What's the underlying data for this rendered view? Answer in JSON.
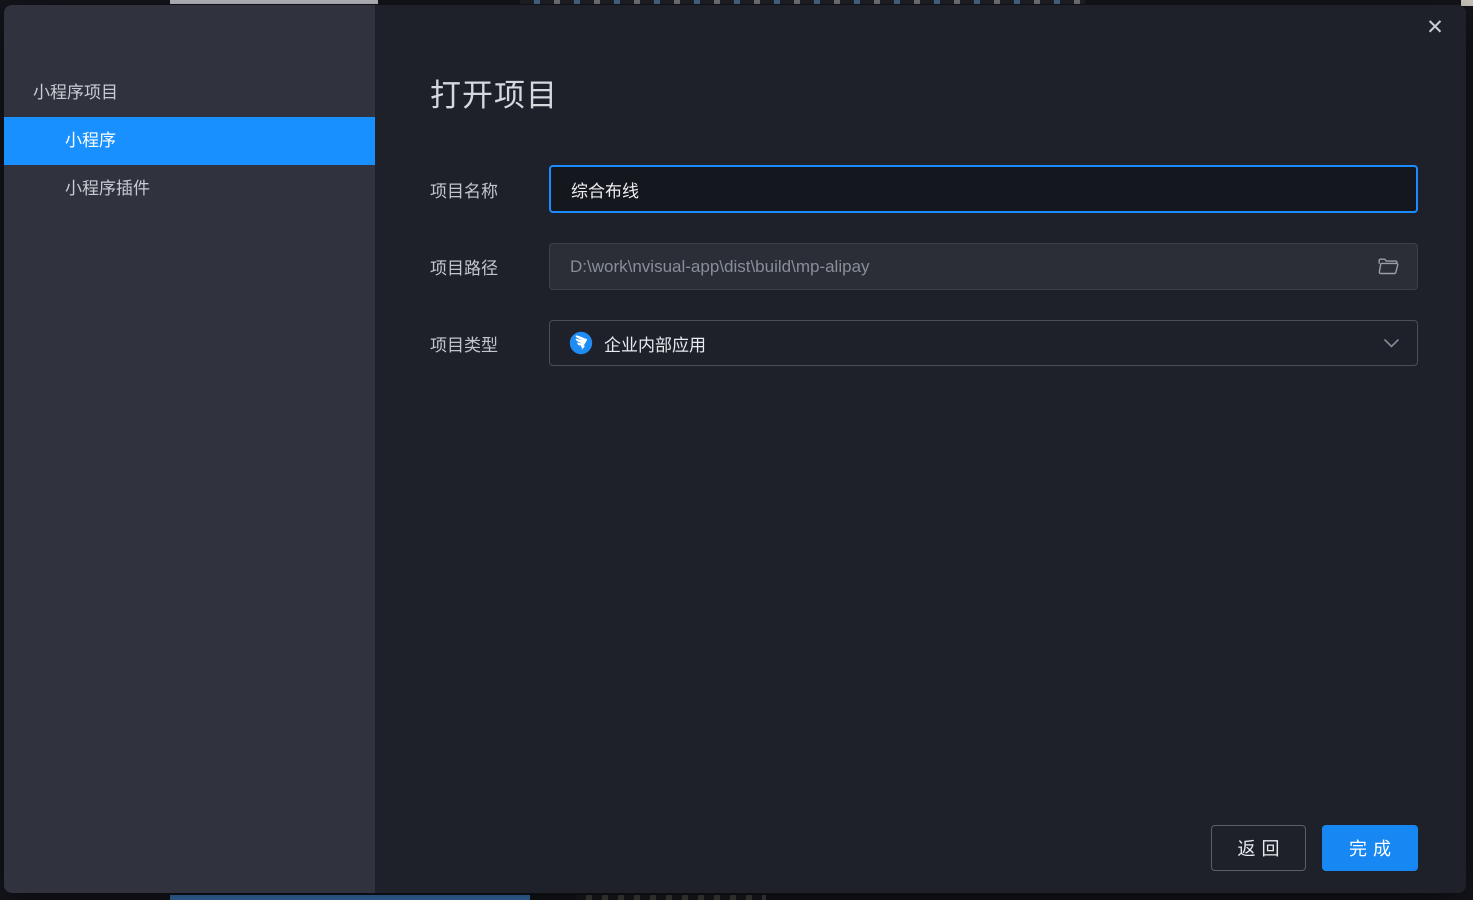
{
  "window": {
    "close_icon": "✕"
  },
  "sidebar": {
    "header": "小程序项目",
    "items": [
      {
        "label": "小程序",
        "selected": true
      },
      {
        "label": "小程序插件",
        "selected": false
      }
    ]
  },
  "main": {
    "title": "打开项目",
    "form": {
      "name_label": "项目名称",
      "name_value": "综合布线",
      "path_label": "项目路径",
      "path_value": "D:\\work\\nvisual-app\\dist\\build\\mp-alipay",
      "type_label": "项目类型",
      "type_value": "企业内部应用"
    },
    "footer": {
      "back": "返回",
      "finish": "完成"
    }
  },
  "icons": {
    "close": "close-icon",
    "folder": "folder-open-icon",
    "chevron": "chevron-down-icon",
    "project_type": "dingtalk-logo-icon"
  },
  "colors": {
    "accent_blue": "#1890ff",
    "finish_button_blue": "#1787f3",
    "sidebar_bg": "#30333d",
    "main_bg": "#1e212a",
    "path_field_bg": "#2b2e36",
    "dingtalk_icon_blue": "#1f8cf4",
    "backdrop": "#14161c"
  }
}
